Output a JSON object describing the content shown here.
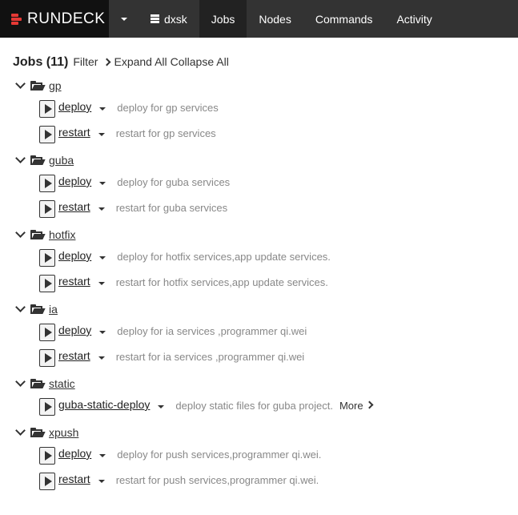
{
  "navbar": {
    "brand": "RUNDECK",
    "project": "dxsk",
    "items": [
      {
        "label": "Jobs",
        "active": true
      },
      {
        "label": "Nodes",
        "active": false
      },
      {
        "label": "Commands",
        "active": false
      },
      {
        "label": "Activity",
        "active": false
      }
    ]
  },
  "header": {
    "title": "Jobs (11)",
    "filter": "Filter",
    "expand_all": "Expand All",
    "collapse_all": "Collapse All"
  },
  "groups": [
    {
      "name": "gp",
      "jobs": [
        {
          "name": "deploy",
          "description": "deploy for gp services"
        },
        {
          "name": "restart",
          "description": "restart for gp services"
        }
      ]
    },
    {
      "name": "guba",
      "jobs": [
        {
          "name": "deploy",
          "description": "deploy for guba services"
        },
        {
          "name": "restart",
          "description": "restart for guba services"
        }
      ]
    },
    {
      "name": "hotfix",
      "jobs": [
        {
          "name": "deploy",
          "description": "deploy for hotfix services,app update services."
        },
        {
          "name": "restart",
          "description": "restart for hotfix services,app update services."
        }
      ]
    },
    {
      "name": "ia",
      "jobs": [
        {
          "name": "deploy",
          "description": "deploy for ia services ,programmer qi.wei"
        },
        {
          "name": "restart",
          "description": "restart for ia services ,programmer qi.wei"
        }
      ]
    },
    {
      "name": "static",
      "jobs": [
        {
          "name": "guba-static-deploy",
          "description": "deploy static files for guba project.",
          "more": "More"
        }
      ]
    },
    {
      "name": "xpush",
      "jobs": [
        {
          "name": "deploy",
          "description": "deploy for push services,programmer qi.wei."
        },
        {
          "name": "restart",
          "description": "restart for push services,programmer qi.wei."
        }
      ]
    }
  ],
  "colors": {
    "navbar_bg": "#333333",
    "brand_bg": "#111111",
    "active_tab_bg": "#222222",
    "logo_red": "#e53935",
    "description_gray": "#888888"
  }
}
